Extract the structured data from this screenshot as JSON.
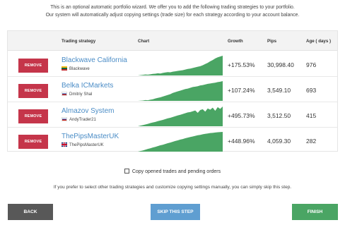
{
  "intro": {
    "line1": "This is an optional automatic portfolio wizard. We offer you to add the following trading strategies to your portfolio.",
    "line2": "Our system will automatically adjust copying settings (trade size) for each strategy according to your account balance."
  },
  "table": {
    "headers": {
      "strategy": "Trading strategy",
      "chart": "Chart",
      "growth": "Growth",
      "pips": "Pips",
      "age": "Age ( days )"
    },
    "remove_label": "REMOVE",
    "rows": [
      {
        "name": "Blackwave California",
        "owner": "Blackwave",
        "flag": "lithuania-flag-icon",
        "growth": "+175.53%",
        "pips": "30,998.40",
        "age": "976",
        "chart": [
          0,
          2,
          3,
          5,
          4,
          6,
          8,
          9,
          11,
          10,
          13,
          15,
          17,
          16,
          19,
          21,
          23,
          25,
          27,
          30,
          33,
          35,
          38,
          41,
          44,
          47,
          52,
          58,
          64,
          72,
          78,
          86,
          92,
          96,
          100
        ]
      },
      {
        "name": "Belka ICMarkets",
        "owner": "Dmitriy Shal",
        "flag": "russia-flag-icon",
        "growth": "+107.24%",
        "pips": "3,549.10",
        "age": "693",
        "chart": [
          0,
          1,
          2,
          4,
          3,
          6,
          8,
          12,
          15,
          18,
          22,
          26,
          30,
          34,
          40,
          44,
          48,
          52,
          56,
          60,
          62,
          66,
          70,
          72,
          74,
          78,
          80,
          83,
          86,
          88,
          90,
          92,
          95,
          97,
          100
        ]
      },
      {
        "name": "Almazov System",
        "owner": "AndyTrader21",
        "flag": "russia-flag-icon",
        "growth": "+495.73%",
        "pips": "3,512.50",
        "age": "415",
        "chart": [
          0,
          3,
          6,
          9,
          12,
          16,
          19,
          22,
          26,
          29,
          32,
          36,
          40,
          43,
          47,
          51,
          55,
          58,
          62,
          66,
          70,
          72,
          76,
          80,
          68,
          82,
          86,
          74,
          90,
          84,
          94,
          78,
          97,
          88,
          100
        ]
      },
      {
        "name": "ThePipsMasterUK",
        "owner": "ThePipsMasterUK",
        "flag": "uk-flag-icon",
        "growth": "+448.96%",
        "pips": "4,059.30",
        "age": "282",
        "chart": [
          0,
          3,
          6,
          10,
          14,
          17,
          21,
          24,
          28,
          32,
          35,
          39,
          43,
          46,
          50,
          54,
          57,
          61,
          64,
          68,
          71,
          74,
          77,
          80,
          83,
          85,
          88,
          90,
          92,
          94,
          95,
          97,
          98,
          99,
          100
        ]
      }
    ]
  },
  "copy_option": {
    "label": "Copy opened trades and pending orders",
    "checked": false
  },
  "skip_note": "If you prefer to select other trading strategies and customize copying settings manually, you can simply skip this step.",
  "buttons": {
    "back": "BACK",
    "skip": "SKIP THIS STEP",
    "finish": "FINISH"
  },
  "colors": {
    "remove": "#c5354a",
    "link": "#4a8cc6",
    "chart_fill": "#4aa564",
    "back": "#585858",
    "skip": "#5f9ed1",
    "finish": "#4aa564"
  }
}
